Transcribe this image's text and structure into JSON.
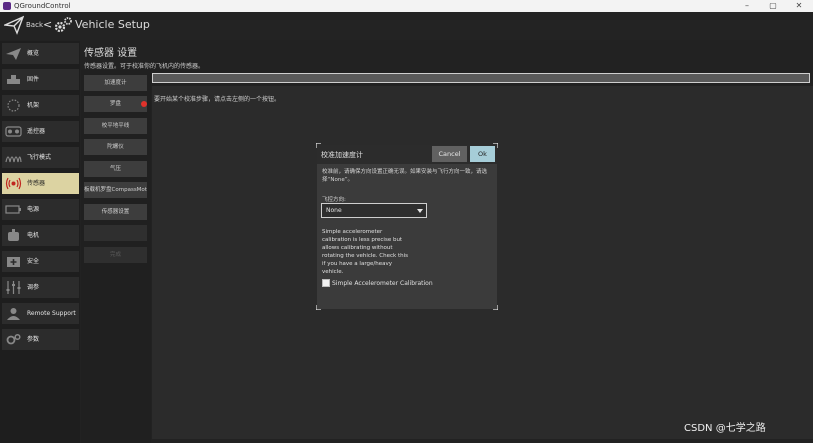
{
  "window": {
    "title": "QGroundControl",
    "controls": [
      "–",
      "▢",
      "✕"
    ]
  },
  "toolbar": {
    "back_label": "Back",
    "separator": "<",
    "title": "Vehicle Setup"
  },
  "sidebar": {
    "items": [
      {
        "label": "概览",
        "icon": "plane-icon"
      },
      {
        "label": "固件",
        "icon": "firmware-icon"
      },
      {
        "label": "机架",
        "icon": "airframe-icon"
      },
      {
        "label": "遥控器",
        "icon": "radio-icon"
      },
      {
        "label": "飞行模式",
        "icon": "flight-modes-icon"
      },
      {
        "label": "传感器",
        "icon": "sensors-icon",
        "active": true
      },
      {
        "label": "电源",
        "icon": "battery-icon"
      },
      {
        "label": "电机",
        "icon": "motor-icon"
      },
      {
        "label": "安全",
        "icon": "safety-icon"
      },
      {
        "label": "调参",
        "icon": "tuning-icon"
      },
      {
        "label": "Remote Support",
        "icon": "remote-support-icon"
      },
      {
        "label": "参数",
        "icon": "parameters-icon"
      }
    ]
  },
  "main": {
    "title": "传感器 设置",
    "description": "传感器设置。可于校准你的飞机内的传感器。",
    "steps_text": "要开始某个校准步骤，请点击左侧的一个按钮。",
    "progress": 0
  },
  "sensor_buttons": [
    {
      "label": "加速度计",
      "enabled": true
    },
    {
      "label": "罗盘",
      "enabled": true,
      "alert": true
    },
    {
      "label": "校平地平线",
      "enabled": true
    },
    {
      "label": "陀螺仪",
      "enabled": true
    },
    {
      "label": "气压",
      "enabled": true
    },
    {
      "label": "板载机罗盘CompassMot",
      "enabled": true
    },
    {
      "label": "传感器设置",
      "enabled": true
    },
    {
      "label": "",
      "enabled": false
    },
    {
      "label": "完成",
      "enabled": false
    }
  ],
  "dialog": {
    "title": "校准加速度计",
    "cancel_label": "Cancel",
    "ok_label": "Ok",
    "instruction": "校准前，请确保方向设置正确无误。如果安装与飞行方向一致，请选择“None”。",
    "rotation_label": "飞控方向:",
    "rotation_value": "None",
    "simple_desc": "Simple accelerometer calibration is less precise but allows calibrating without rotating the vehicle. Check this if you have a large/heavy vehicle.",
    "checkbox_label": "Simple Accelerometer Calibration",
    "checkbox_checked": false
  },
  "watermark": "CSDN @七学之路",
  "colors": {
    "active_item": "#dcd3a2",
    "ok_button": "#a6cdd8",
    "alert_dot": "#e0322b"
  }
}
